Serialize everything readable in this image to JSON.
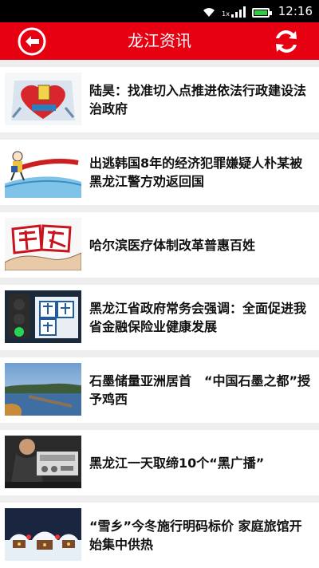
{
  "status_bar": {
    "time": "12:16",
    "network": "1x",
    "icons": [
      "wifi-icon",
      "signal-icon",
      "battery-icon"
    ]
  },
  "header": {
    "title": "龙江资讯",
    "accent_color": "#e60012",
    "back_icon": "back-arrow-icon",
    "refresh_icon": "refresh-icon"
  },
  "news": [
    {
      "title": "陆昊：找准切入点推进依法行政建设法治政府",
      "thumb": "heart-ballot-illustration"
    },
    {
      "title": "出逃韩国8年的经济犯罪嫌疑人朴某被黑龙江警方劝返回国",
      "thumb": "fugitive-cartoon-illustration"
    },
    {
      "title": "哈尔滨医疗体制改革普惠百姓",
      "thumb": "medical-reform-illustration"
    },
    {
      "title": "黑龙江省政府常务会强调：全面促进我省金融保险业健康发展",
      "thumb": "insurance-photo"
    },
    {
      "title": "石墨储量亚洲居首　“中国石墨之都”授予鸡西",
      "thumb": "lake-landscape-photo"
    },
    {
      "title": "黑龙江一天取缔10个“黑广播”",
      "thumb": "radio-equipment-photo"
    },
    {
      "title": "“雪乡”今冬施行明码标价 家庭旅馆开始集中供热",
      "thumb": "snow-village-photo"
    }
  ]
}
